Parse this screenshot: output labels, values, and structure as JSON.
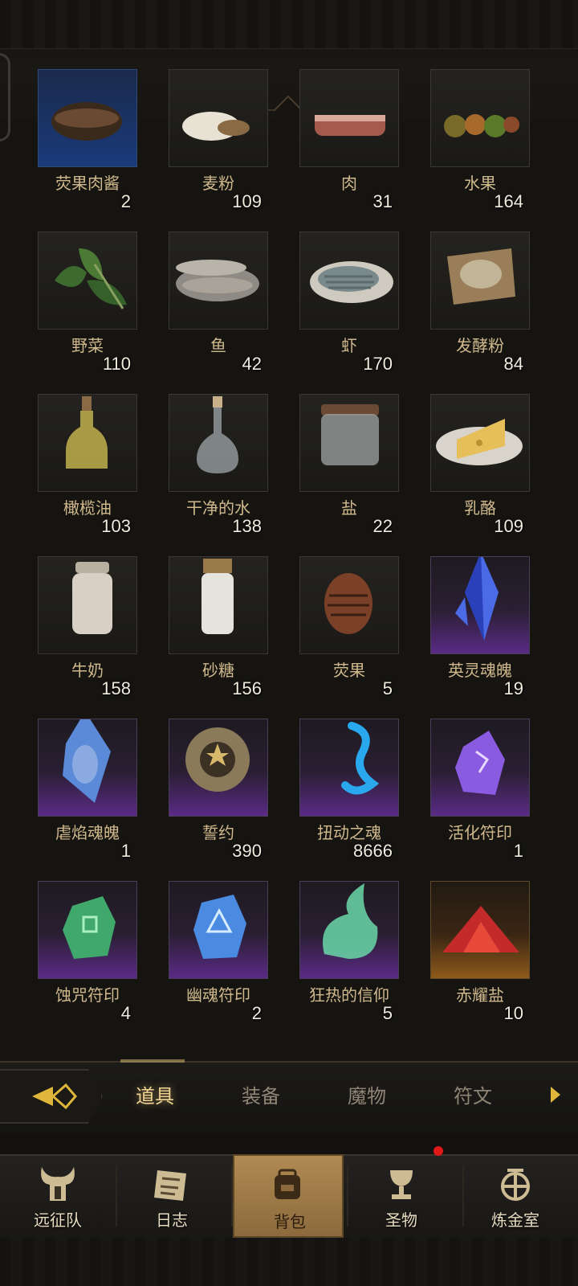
{
  "inventory": {
    "items": [
      {
        "name": "荧果肉酱",
        "count": "2"
      },
      {
        "name": "麦粉",
        "count": "109"
      },
      {
        "name": "肉",
        "count": "31"
      },
      {
        "name": "水果",
        "count": "164"
      },
      {
        "name": "野菜",
        "count": "110"
      },
      {
        "name": "鱼",
        "count": "42"
      },
      {
        "name": "虾",
        "count": "170"
      },
      {
        "name": "发酵粉",
        "count": "84"
      },
      {
        "name": "橄榄油",
        "count": "103"
      },
      {
        "name": "干净的水",
        "count": "138"
      },
      {
        "name": "盐",
        "count": "22"
      },
      {
        "name": "乳酪",
        "count": "109"
      },
      {
        "name": "牛奶",
        "count": "158"
      },
      {
        "name": "砂糖",
        "count": "156"
      },
      {
        "name": "荧果",
        "count": "5"
      },
      {
        "name": "英灵魂魄",
        "count": "19"
      },
      {
        "name": "虐焰魂魄",
        "count": "1"
      },
      {
        "name": "誓约",
        "count": "390"
      },
      {
        "name": "扭动之魂",
        "count": "8666"
      },
      {
        "name": "活化符印",
        "count": "1"
      },
      {
        "name": "蚀咒符印",
        "count": "4"
      },
      {
        "name": "幽魂符印",
        "count": "2"
      },
      {
        "name": "狂热的信仰",
        "count": "5"
      },
      {
        "name": "赤耀盐",
        "count": "10"
      }
    ]
  },
  "tabs": {
    "items": [
      {
        "label": "道具",
        "active": true
      },
      {
        "label": "装备"
      },
      {
        "label": "魔物"
      },
      {
        "label": "符文"
      }
    ]
  },
  "bottom_nav": {
    "items": [
      {
        "label": "远征队",
        "icon": "horned-helmet-icon"
      },
      {
        "label": "日志",
        "icon": "scroll-icon"
      },
      {
        "label": "背包",
        "icon": "backpack-icon",
        "active": true
      },
      {
        "label": "圣物",
        "icon": "chalice-icon",
        "badge": true
      },
      {
        "label": "炼金室",
        "icon": "alchemy-icon"
      }
    ]
  },
  "colors": {
    "background": "#151411",
    "item_name": "#d0b98c",
    "tab_active": "#f0d392",
    "epic": "#5a2a86",
    "legendary": "#8f5a1a",
    "badge": "#e01818"
  }
}
